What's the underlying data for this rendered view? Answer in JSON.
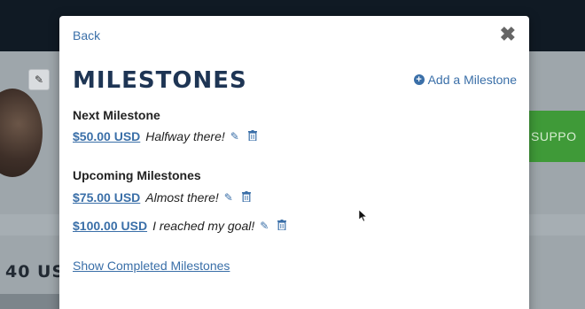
{
  "modal": {
    "back_label": "Back",
    "title": "MILESTONES",
    "add_label": "Add a Milestone",
    "next_label": "Next Milestone",
    "upcoming_label": "Upcoming Milestones",
    "show_completed_label": "Show Completed Milestones"
  },
  "next_milestone": {
    "amount": "$50.00 USD",
    "description": "Halfway there!"
  },
  "upcoming": [
    {
      "amount": "$75.00 USD",
      "description": "Almost there!"
    },
    {
      "amount": "$100.00 USD",
      "description": "I reached my goal!"
    }
  ],
  "background": {
    "amount_fragment": "40 US",
    "support_fragment": "SUPPO"
  },
  "colors": {
    "link": "#3a6fa8",
    "title": "#1e3554",
    "support": "#3f9a38"
  },
  "icons": {
    "close": "close-icon",
    "add": "plus-circle-icon",
    "edit": "pencil-icon",
    "delete": "trash-icon"
  }
}
